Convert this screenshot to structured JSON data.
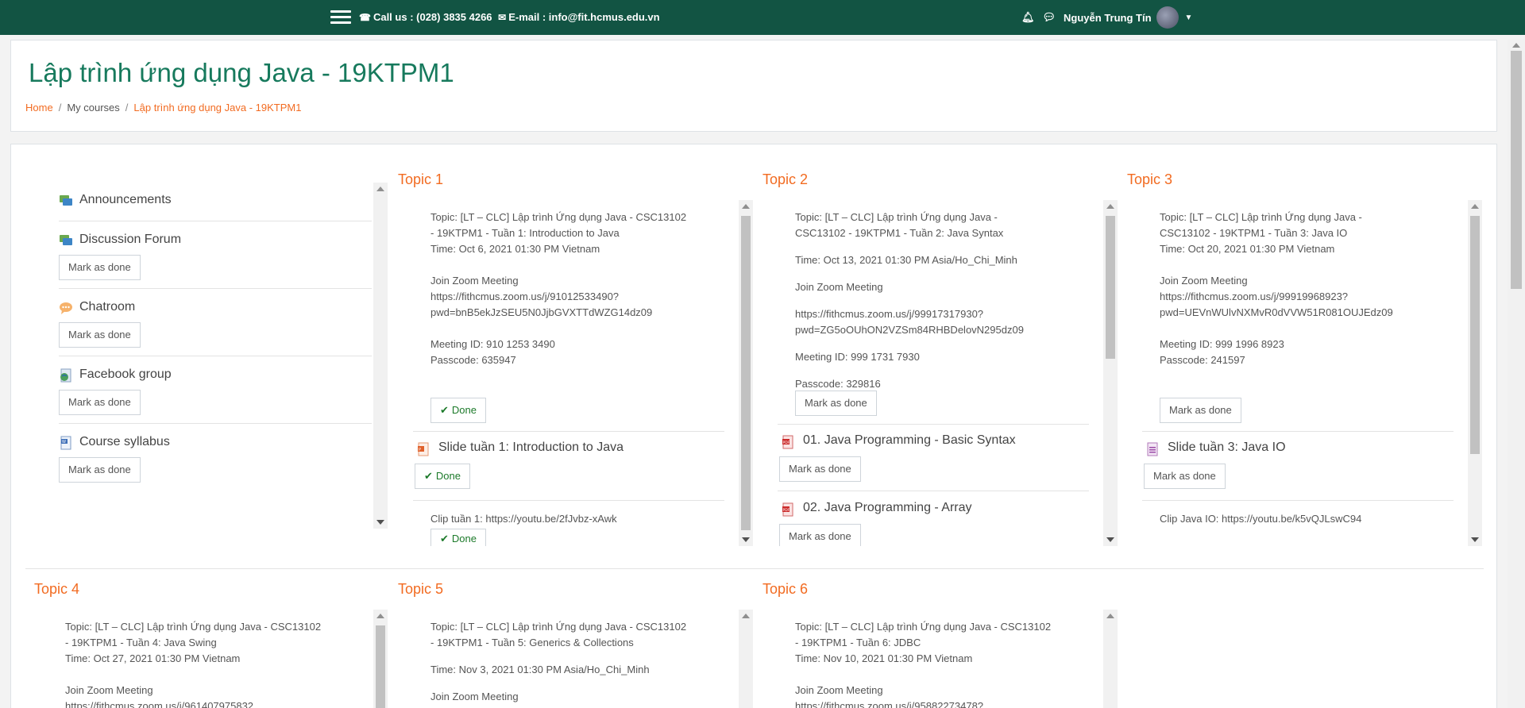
{
  "navbar": {
    "menu_icon": "hamburger-icon",
    "phone_text": "Call us : (028) 3835 4266",
    "email_text": "E-mail : info@fit.hcmus.edu.vn",
    "user_name": "Nguyễn Trung Tín"
  },
  "header": {
    "title": "Lập trình ứng dụng Java - 19KTPM1",
    "breadcrumb": [
      "Home",
      "My courses",
      "Lập trình ứng dụng Java - 19KTPM1"
    ]
  },
  "sidebar": {
    "items": [
      {
        "label": "Announcements",
        "icon": "forum-icon",
        "button": ""
      },
      {
        "label": "Discussion Forum",
        "icon": "forum-icon",
        "button": "Mark as done"
      },
      {
        "label": "Chatroom",
        "icon": "chat-icon",
        "button": "Mark as done"
      },
      {
        "label": "Facebook group",
        "icon": "url-icon",
        "button": "Mark as done"
      },
      {
        "label": "Course syllabus",
        "icon": "document-icon",
        "button": "Mark as done"
      }
    ]
  },
  "topics": [
    {
      "title": "Topic 1",
      "lines": [
        "Topic: [LT – CLC] Lập trình Ứng dụng Java - CSC13102",
        "- 19KTPM1 - Tuần 1: Introduction to Java",
        "Time: Oct 6, 2021 01:30 PM Vietnam",
        "",
        "Join Zoom Meeting",
        "https://fithcmus.zoom.us/j/91012533490?",
        "pwd=bnB5ekJzSEU5N0JjbGVXTTdWZG14dz09",
        "",
        "Meeting ID: 910 1253 3490",
        "Passcode: 635947"
      ],
      "button": "Done",
      "activity1": "Slide tuần 1: Introduction to Java",
      "activity1_button": "Done",
      "activity2": "Clip tuần 1: https://youtu.be/2fJvbz-xAwk",
      "activity2_button": "Done"
    },
    {
      "title": "Topic 2",
      "lines": [
        "Topic:  [LT – CLC] Lập trình Ứng dụng Java -",
        "CSC13102 - 19KTPM1 - Tuần 2: Java Syntax",
        "",
        "Time: Oct 13, 2021 01:30 PM Asia/Ho_Chi_Minh",
        "",
        "Join Zoom Meeting",
        "",
        "https://fithcmus.zoom.us/j/99917317930?",
        "pwd=ZG5oOUhON2VZSm84RHBDelovN295dz09",
        "",
        "Meeting ID: 999 1731 7930",
        "",
        "Passcode: 329816"
      ],
      "button": "Mark as done",
      "activity1": "01. Java Programming - Basic Syntax",
      "activity1_button": "Mark as done",
      "activity2": "02. Java Programming - Array",
      "activity2_button": "Mark as done"
    },
    {
      "title": "Topic 3",
      "lines": [
        "Topic:  [LT – CLC] Lập trình Ứng dụng Java -",
        "CSC13102 - 19KTPM1 - Tuần 3: Java IO",
        "Time: Oct 20, 2021 01:30 PM Vietnam",
        "",
        "Join Zoom Meeting",
        "https://fithcmus.zoom.us/j/99919968923?",
        "pwd=UEVnWUlvNXMvR0dVVW51R081OUJEdz09",
        "",
        "Meeting ID: 999 1996 8923",
        "Passcode: 241597"
      ],
      "button": "Mark as done",
      "activity1": "Slide tuần 3: Java IO",
      "activity1_button": "Mark as done",
      "activity2": "Clip Java IO: https://youtu.be/k5vQJLswC94"
    },
    {
      "title": "Topic 4",
      "lines": [
        "Topic: [LT – CLC] Lập trình Ứng dụng Java - CSC13102",
        "- 19KTPM1 - Tuần 4: Java Swing",
        "Time: Oct 27, 2021 01:30 PM Vietnam",
        "",
        "Join Zoom Meeting",
        "https://fithcmus.zoom.us/j/961407975832"
      ]
    },
    {
      "title": "Topic 5",
      "lines": [
        "Topic: [LT – CLC] Lập trình Ứng dụng Java - CSC13102",
        "- 19KTPM1 - Tuần 5: Generics & Collections",
        "",
        "Time: Nov 3, 2021 01:30 PM Asia/Ho_Chi_Minh",
        "",
        "Join Zoom Meeting"
      ]
    },
    {
      "title": "Topic 6",
      "lines": [
        "Topic: [LT – CLC] Lập trình Ứng dụng Java - CSC13102",
        "- 19KTPM1 - Tuần 6: JDBC",
        "Time: Nov 10, 2021 01:30 PM Vietnam",
        "",
        "Join Zoom Meeting",
        "https://fithcmus.zoom.us/j/95882273478?"
      ]
    }
  ]
}
